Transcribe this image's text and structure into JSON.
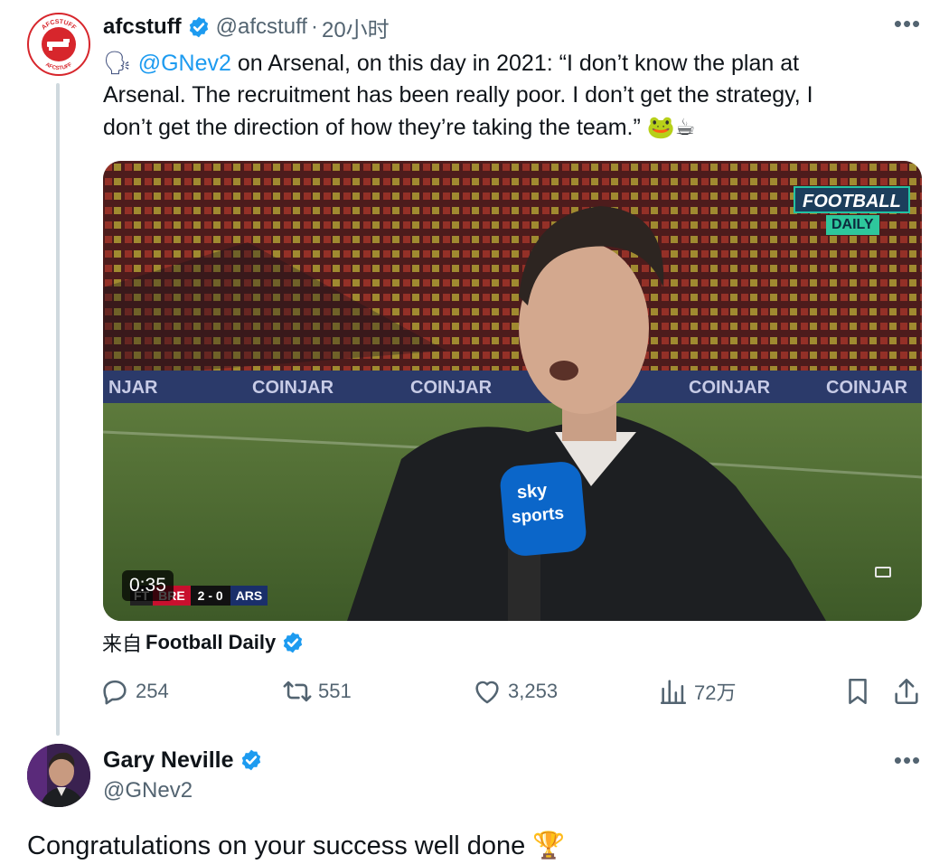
{
  "tweet": {
    "author_name": "afcstuff",
    "author_handle": "@afcstuff",
    "separator": "·",
    "time": "20小时",
    "avatar_text_top": "AFCSTUFF",
    "avatar_text_bottom": "AFCSTUFF",
    "text_emoji_lead": "🗣",
    "mention": "@GNev2",
    "text_line1_rest": " on Arsenal, on this day in 2021: “I don’t know the plan at",
    "text_line2": "Arsenal. The recruitment has been really poor. I don’t get the strategy, I",
    "text_line3": "don’t get the direction of how they’re taking the team.”",
    "text_emoji_tail": "🐸☕",
    "video": {
      "duration": "0:35",
      "watermark_top": "FOOTBALL",
      "watermark_bottom": "DAILY",
      "board_text": "COINJAR",
      "board_partial": "NJAR",
      "score_period": "FT",
      "score_home": "BRE",
      "score": "2 - 0",
      "score_away": "ARS",
      "mic_top": "sky",
      "mic_bottom": "sports"
    },
    "source_prefix": "来自",
    "source_name": "Football Daily",
    "stats": {
      "replies": "254",
      "retweets": "551",
      "likes": "3,253",
      "views": "72万"
    },
    "more_label": "•••"
  },
  "reply": {
    "author_name": "Gary Neville",
    "author_handle": "@GNev2",
    "text": "Congratulations on your success well done",
    "text_emoji": "🏆",
    "more_label": "•••"
  },
  "colors": {
    "accent": "#1d9bf0",
    "muted": "#536471",
    "text": "#0f1419",
    "verified": "#1d9bf0",
    "arsenal_red": "#d7262c"
  },
  "icons": [
    "verified-badge-icon",
    "more-icon",
    "reply-icon",
    "retweet-icon",
    "like-icon",
    "views-icon",
    "bookmark-icon",
    "share-icon",
    "trophy-icon",
    "frog-icon",
    "tea-icon",
    "speaking-head-icon",
    "fullscreen-icon"
  ]
}
